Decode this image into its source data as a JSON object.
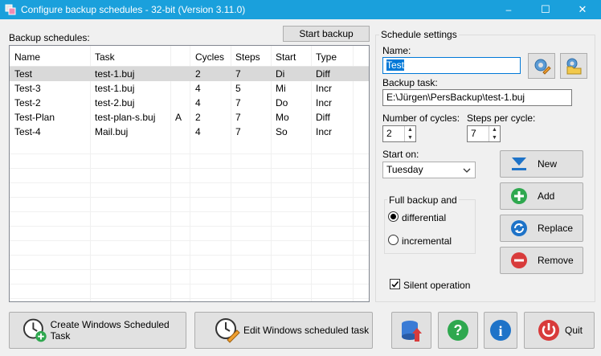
{
  "window": {
    "title": "Configure backup schedules - 32-bit (Version 3.11.0)",
    "minimize": "–",
    "maximize": "☐",
    "close": "✕"
  },
  "schedules": {
    "label": "Backup schedules:",
    "start_backup": "Start backup",
    "columns": [
      "Name",
      "Task",
      "",
      "Cycles",
      "Steps",
      "Start",
      "Type"
    ],
    "rows": [
      {
        "name": "Test",
        "task": "test-1.buj",
        "flag": "",
        "cycles": "2",
        "steps": "7",
        "start": "Di",
        "type": "Diff",
        "selected": true
      },
      {
        "name": "Test-3",
        "task": "test-1.buj",
        "flag": "",
        "cycles": "4",
        "steps": "5",
        "start": "Mi",
        "type": "Incr",
        "selected": false
      },
      {
        "name": "Test-2",
        "task": "test-2.buj",
        "flag": "",
        "cycles": "4",
        "steps": "7",
        "start": "Do",
        "type": "Incr",
        "selected": false
      },
      {
        "name": "Test-Plan",
        "task": "test-plan-s.buj",
        "flag": "A",
        "cycles": "2",
        "steps": "7",
        "start": "Mo",
        "type": "Diff",
        "selected": false
      },
      {
        "name": "Test-4",
        "task": "Mail.buj",
        "flag": "",
        "cycles": "4",
        "steps": "7",
        "start": "So",
        "type": "Incr",
        "selected": false
      }
    ]
  },
  "settings": {
    "group_label": "Schedule settings",
    "name_label": "Name:",
    "name_value": "Test",
    "task_label": "Backup task:",
    "task_value": "E:\\Jürgen\\PersBackup\\test-1.buj",
    "cycles_label": "Number of cycles:",
    "cycles_value": "2",
    "steps_label": "Steps per cycle:",
    "steps_value": "7",
    "start_label": "Start on:",
    "start_value": "Tuesday",
    "full_backup_label": "Full backup and",
    "differential": "differential",
    "incremental": "incremental",
    "silent": "Silent operation",
    "new": "New",
    "add": "Add",
    "replace": "Replace",
    "remove": "Remove"
  },
  "footer": {
    "create_task": "Create Windows Scheduled Task",
    "edit_task": "Edit Windows scheduled task",
    "quit": "Quit"
  },
  "colors": {
    "titlebar": "#1aa0dc",
    "selection": "#0078d7",
    "green": "#2fa84f",
    "red": "#d83b3b",
    "blue": "#1e73c8"
  }
}
